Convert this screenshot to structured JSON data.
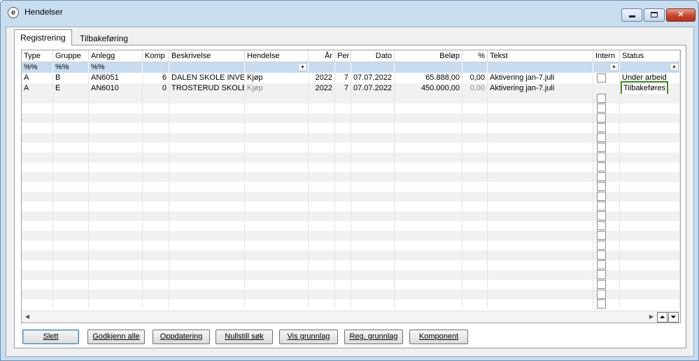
{
  "window": {
    "title": "Hendelser",
    "app_icon": "e-logo-icon"
  },
  "tabs": [
    {
      "label": "Registrering",
      "active": true
    },
    {
      "label": "Tilbakeføring",
      "active": false
    }
  ],
  "columns": [
    "Type",
    "Gruppe",
    "Anlegg",
    "Komp",
    "Beskrivelse",
    "Hendelse",
    "År",
    "Per",
    "Dato",
    "Beløp",
    "%",
    "Tekst",
    "Intern",
    "Status"
  ],
  "filters": {
    "type": "%%",
    "gruppe": "%%",
    "anlegg": "%%"
  },
  "rows": [
    {
      "type": "A",
      "gruppe": "B",
      "anlegg": "AN6051",
      "komp": "6",
      "beskrivelse": "DALEN SKOLE INVENT",
      "hendelse": "Kjøp",
      "aar": "2022",
      "per": "7",
      "dato": "07.07.2022",
      "belop": "65.888,00",
      "pct": "0,00",
      "tekst": "Aktivering jan-7.juli",
      "intern": false,
      "status": "Under arbeid"
    },
    {
      "type": "A",
      "gruppe": "E",
      "anlegg": "AN6010",
      "komp": "0",
      "beskrivelse": "TROSTERUD SKOLE",
      "hendelse": "Kjøp",
      "aar": "2022",
      "per": "7",
      "dato": "07.07.2022",
      "belop": "450.000,00",
      "pct": "0,00",
      "tekst": "Aktivering jan-7.juli",
      "intern": false,
      "status": "Tilbakeføres"
    }
  ],
  "buttons": [
    "Slett",
    "Godkjenn alle",
    "Oppdatering",
    "Nullstill søk",
    "Vis grunnlag",
    "Reg. grunnlag",
    "Komponent"
  ],
  "colors": {
    "filter_row": "#c7dcf1",
    "highlight_border": "#3b8e1d",
    "close_button": "#c9442b"
  }
}
